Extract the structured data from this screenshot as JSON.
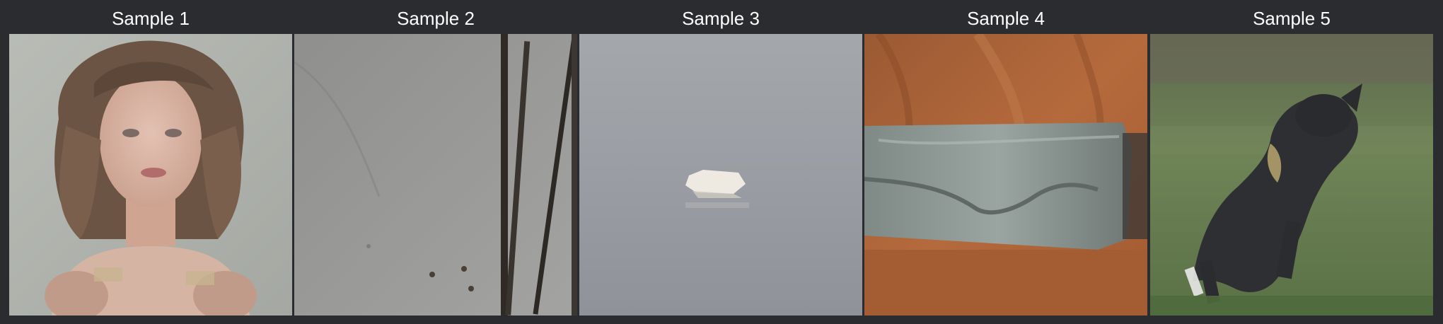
{
  "samples": [
    {
      "title": "Sample 1",
      "depicts": "portrait-woman-bob-hair"
    },
    {
      "title": "Sample 2",
      "depicts": "grey-wall-branches"
    },
    {
      "title": "Sample 3",
      "depicts": "small-floating-object-grey"
    },
    {
      "title": "Sample 4",
      "depicts": "grey-stone-on-wood"
    },
    {
      "title": "Sample 5",
      "depicts": "dog-jumping-grass"
    }
  ]
}
